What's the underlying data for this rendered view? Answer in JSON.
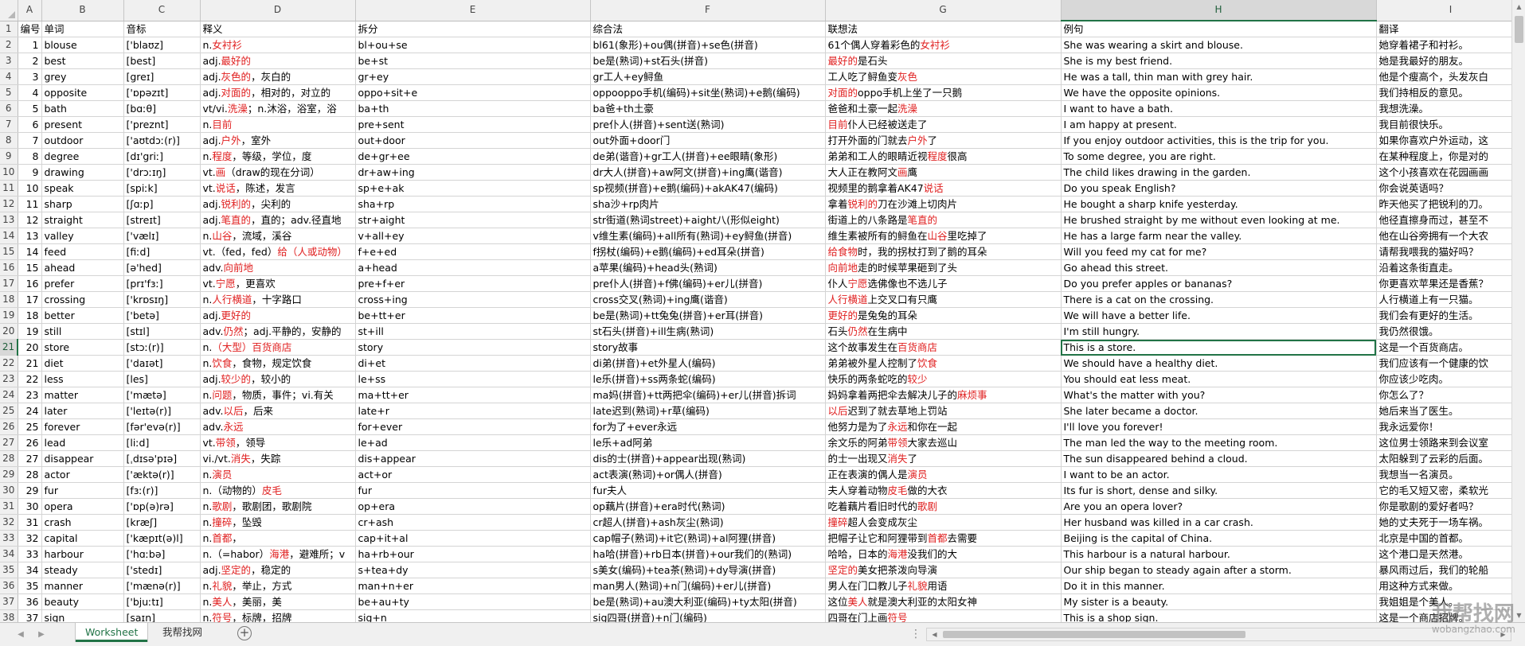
{
  "columns": [
    "A",
    "B",
    "C",
    "D",
    "E",
    "F",
    "G",
    "H",
    "I"
  ],
  "selected_column": "H",
  "selected_row": "21",
  "headers": [
    "编号",
    "单词",
    "音标",
    "释义",
    "拆分",
    "综合法",
    "联想法",
    "例句",
    "翻译"
  ],
  "rows": [
    [
      "1",
      "blouse",
      "['blaʊz]",
      [
        [
          "n.",
          ""
        ],
        [
          "女衬衫",
          "r"
        ]
      ],
      "bl+ou+se",
      "bl61(象形)+ou偶(拼音)+se色(拼音)",
      [
        [
          "61个偶人穿着彩色的",
          ""
        ],
        [
          "女衬衫",
          "r"
        ]
      ],
      "She was wearing a skirt and blouse.",
      "她穿着裙子和衬衫。"
    ],
    [
      "2",
      "best",
      "[best]",
      [
        [
          "adj.",
          ""
        ],
        [
          "最好的",
          "r"
        ]
      ],
      "be+st",
      "be是(熟词)+st石头(拼音)",
      [
        [
          "最好的",
          "r"
        ],
        [
          "是石头",
          ""
        ]
      ],
      "She is my best friend.",
      "她是我最好的朋友。"
    ],
    [
      "3",
      "grey",
      "[greɪ]",
      [
        [
          "adj.",
          ""
        ],
        [
          "灰色的",
          "r"
        ],
        [
          "，灰白的",
          ""
        ]
      ],
      "gr+ey",
      "gr工人+ey鲟鱼",
      [
        [
          "工人吃了鲟鱼变",
          ""
        ],
        [
          "灰色",
          "r"
        ]
      ],
      "He was a tall, thin man with grey hair.",
      "他是个瘦高个，头发灰白"
    ],
    [
      "4",
      "opposite",
      "['ɒpəzɪt]",
      [
        [
          "adj.",
          ""
        ],
        [
          "对面的",
          "r"
        ],
        [
          "，相对的，对立的",
          ""
        ]
      ],
      "oppo+sit+e",
      "oppooppo手机(编码)+sit坐(熟词)+e鹅(编码)",
      [
        [
          "对面的",
          "r"
        ],
        [
          "oppo手机上坐了一只鹅",
          ""
        ]
      ],
      "We have the opposite opinions.",
      "我们持相反的意见。"
    ],
    [
      "5",
      "bath",
      "[bɑːθ]",
      [
        [
          "vt/vi.",
          ""
        ],
        [
          "洗澡",
          "r"
        ],
        [
          "；n.沐浴，浴室，浴",
          ""
        ]
      ],
      "ba+th",
      "ba爸+th土豪",
      [
        [
          "爸爸和土豪一起",
          ""
        ],
        [
          "洗澡",
          "r"
        ]
      ],
      "I want to have a bath.",
      "我想洗澡。"
    ],
    [
      "6",
      "present",
      "['preznt]",
      [
        [
          "n.",
          ""
        ],
        [
          "目前",
          "r"
        ]
      ],
      "pre+sent",
      "pre仆人(拼音)+sent送(熟词)",
      [
        [
          "目前",
          "r"
        ],
        [
          "仆人已经被送走了",
          ""
        ]
      ],
      "I am happy at present.",
      "我目前很快乐。"
    ],
    [
      "7",
      "outdoor",
      "['aʊtdɔː(r)]",
      [
        [
          "adj.",
          ""
        ],
        [
          "户外",
          "r"
        ],
        [
          "，室外",
          ""
        ]
      ],
      "out+door",
      "out外面+door门",
      [
        [
          "打开外面的门就去",
          ""
        ],
        [
          "户外",
          "r"
        ],
        [
          "了",
          ""
        ]
      ],
      "If you enjoy outdoor activities, this is the trip for you.",
      "如果你喜欢户外运动，这"
    ],
    [
      "8",
      "degree",
      "[dɪ'griː]",
      [
        [
          "n.",
          ""
        ],
        [
          "程度",
          "r"
        ],
        [
          "，等级，学位，度",
          ""
        ]
      ],
      "de+gr+ee",
      "de弟(谐音)+gr工人(拼音)+ee眼睛(象形)",
      [
        [
          "弟弟和工人的眼睛近视",
          ""
        ],
        [
          "程度",
          "r"
        ],
        [
          "很高",
          ""
        ]
      ],
      "To some degree, you are right.",
      "在某种程度上，你是对的"
    ],
    [
      "9",
      "drawing",
      "['drɔːɪŋ]",
      [
        [
          "vt.",
          ""
        ],
        [
          "画",
          "r"
        ],
        [
          "（draw的现在分词）",
          ""
        ]
      ],
      "dr+aw+ing",
      "dr大人(拼音)+aw阿文(拼音)+ing鹰(谐音)",
      [
        [
          "大人正在教阿文",
          ""
        ],
        [
          "画",
          "r"
        ],
        [
          "鹰",
          ""
        ]
      ],
      "The child likes drawing in the garden.",
      "这个小孩喜欢在花园画画"
    ],
    [
      "10",
      "speak",
      "[spiːk]",
      [
        [
          "vt.",
          ""
        ],
        [
          "说话",
          "r"
        ],
        [
          "，陈述，发言",
          ""
        ]
      ],
      "sp+e+ak",
      "sp视频(拼音)+e鹅(编码)+akAK47(编码)",
      [
        [
          "视频里的鹅拿着AK47",
          ""
        ],
        [
          "说话",
          "r"
        ]
      ],
      "Do you speak English?",
      "你会说英语吗？"
    ],
    [
      "11",
      "sharp",
      "[ʃɑːp]",
      [
        [
          "adj.",
          ""
        ],
        [
          "锐利的",
          "r"
        ],
        [
          "，尖利的",
          ""
        ]
      ],
      "sha+rp",
      "sha沙+rp肉片",
      [
        [
          "拿着",
          ""
        ],
        [
          "锐利的",
          "r"
        ],
        [
          "刀在沙滩上切肉片",
          ""
        ]
      ],
      "He bought a sharp knife yesterday.",
      "昨天他买了把锐利的刀。"
    ],
    [
      "12",
      "straight",
      "[streɪt]",
      [
        [
          "adj.",
          ""
        ],
        [
          "笔直的",
          "r"
        ],
        [
          "，直的；adv.径直地",
          ""
        ]
      ],
      "str+aight",
      "str街道(熟词street)+aight八(形似eight)",
      [
        [
          "街道上的八条路是",
          ""
        ],
        [
          "笔直的",
          "r"
        ]
      ],
      "He brushed straight by me without even looking at me.",
      "他径直擦身而过，甚至不"
    ],
    [
      "13",
      "valley",
      "['vælɪ]",
      [
        [
          "n.",
          ""
        ],
        [
          "山谷",
          "r"
        ],
        [
          "，流域，溪谷",
          ""
        ]
      ],
      "v+all+ey",
      "v维生素(编码)+all所有(熟词)+ey鲟鱼(拼音)",
      [
        [
          "维生素被所有的鲟鱼在",
          ""
        ],
        [
          "山谷",
          "r"
        ],
        [
          "里吃掉了",
          ""
        ]
      ],
      "He has a large farm near the valley.",
      "他在山谷旁拥有一个大农"
    ],
    [
      "14",
      "feed",
      "[fiːd]",
      [
        [
          "vt.（fed，fed）",
          ""
        ],
        [
          "给（人或动物）",
          "r"
        ]
      ],
      "f+e+ed",
      "f拐杖(编码)+e鹅(编码)+ed耳朵(拼音)",
      [
        [
          "给食物",
          "r"
        ],
        [
          "时，我的拐杖打到了鹅的耳朵",
          ""
        ]
      ],
      "Will you feed my cat for me?",
      "请帮我喂我的猫好吗？"
    ],
    [
      "15",
      "ahead",
      "[ə'hed]",
      [
        [
          "adv.",
          ""
        ],
        [
          "向前地",
          "r"
        ]
      ],
      "a+head",
      "a苹果(编码)+head头(熟词)",
      [
        [
          "向前地",
          "r"
        ],
        [
          "走的时候苹果砸到了头",
          ""
        ]
      ],
      "Go ahead this street.",
      "沿着这条街直走。"
    ],
    [
      "16",
      "prefer",
      "[prɪ'fɜː]",
      [
        [
          "vt.",
          ""
        ],
        [
          "宁愿",
          "r"
        ],
        [
          "，更喜欢",
          ""
        ]
      ],
      "pre+f+er",
      "pre仆人(拼音)+f佛(编码)+er儿(拼音)",
      [
        [
          "仆人",
          ""
        ],
        [
          "宁愿",
          "r"
        ],
        [
          "选佛像也不选儿子",
          ""
        ]
      ],
      "Do you prefer apples or bananas?",
      "你更喜欢苹果还是香蕉？"
    ],
    [
      "17",
      "crossing",
      "['krɒsɪŋ]",
      [
        [
          "n.",
          ""
        ],
        [
          "人行横道",
          "r"
        ],
        [
          "，十字路口",
          ""
        ]
      ],
      "cross+ing",
      "cross交叉(熟词)+ing鹰(谐音)",
      [
        [
          "人行横道",
          "r"
        ],
        [
          "上交叉口有只鹰",
          ""
        ]
      ],
      "There is a cat on the crossing.",
      "人行横道上有一只猫。"
    ],
    [
      "18",
      "better",
      "['betə]",
      [
        [
          "adj.",
          ""
        ],
        [
          "更好的",
          "r"
        ]
      ],
      "be+tt+er",
      "be是(熟词)+tt兔兔(拼音)+er耳(拼音)",
      [
        [
          "更好的",
          "r"
        ],
        [
          "是兔兔的耳朵",
          ""
        ]
      ],
      "We will have a better life.",
      "我们会有更好的生活。"
    ],
    [
      "19",
      "still",
      "[stɪl]",
      [
        [
          "adv.",
          ""
        ],
        [
          "仍然",
          "r"
        ],
        [
          "；adj.平静的，安静的",
          ""
        ]
      ],
      "st+ill",
      "st石头(拼音)+ill生病(熟词)",
      [
        [
          "石头",
          ""
        ],
        [
          "仍然",
          "r"
        ],
        [
          "在生病中",
          ""
        ]
      ],
      "I'm still hungry.",
      "我仍然很饿。"
    ],
    [
      "20",
      "store",
      "[stɔː(r)]",
      [
        [
          "n.",
          ""
        ],
        [
          "（大型）百货商店",
          "r"
        ]
      ],
      "story",
      "story故事",
      [
        [
          "这个故事发生在",
          ""
        ],
        [
          "百货商店",
          "r"
        ]
      ],
      "This is a store.",
      "这是一个百货商店。"
    ],
    [
      "21",
      "diet",
      "['daɪət]",
      [
        [
          "n.",
          ""
        ],
        [
          "饮食",
          "r"
        ],
        [
          "，食物，规定饮食",
          ""
        ]
      ],
      "di+et",
      "di弟(拼音)+et外星人(编码)",
      [
        [
          "弟弟被外星人控制了",
          ""
        ],
        [
          "饮食",
          "r"
        ]
      ],
      "We should have a healthy diet.",
      "我们应该有一个健康的饮"
    ],
    [
      "22",
      "less",
      "[les]",
      [
        [
          "adj.",
          ""
        ],
        [
          "较少的",
          "r"
        ],
        [
          "，较小的",
          ""
        ]
      ],
      "le+ss",
      "le乐(拼音)+ss两条蛇(编码)",
      [
        [
          "快乐的两条蛇吃的",
          ""
        ],
        [
          "较少",
          "r"
        ]
      ],
      "You should eat less meat.",
      "你应该少吃肉。"
    ],
    [
      "23",
      "matter",
      "['mætə]",
      [
        [
          "n.",
          ""
        ],
        [
          "问题",
          "r"
        ],
        [
          "，物质，事件；vi.有关",
          ""
        ]
      ],
      "ma+tt+er",
      "ma妈(拼音)+tt两把伞(编码)+er儿(拼音)拆词",
      [
        [
          "妈妈拿着两把伞去解决儿子的",
          ""
        ],
        [
          "麻烦事",
          "r"
        ]
      ],
      "What's the matter with you?",
      "你怎么了？"
    ],
    [
      "24",
      "later",
      "['leɪtə(r)]",
      [
        [
          "adv.",
          ""
        ],
        [
          "以后",
          "r"
        ],
        [
          "，后来",
          ""
        ]
      ],
      "late+r",
      "late迟到(熟词)+r草(编码)",
      [
        [
          "以后",
          "r"
        ],
        [
          "迟到了就去草地上罚站",
          ""
        ]
      ],
      "She later became a doctor.",
      "她后来当了医生。"
    ],
    [
      "25",
      "forever",
      "[fər'evə(r)]",
      [
        [
          "adv.",
          ""
        ],
        [
          "永远",
          "r"
        ]
      ],
      "for+ever",
      "for为了+ever永远",
      [
        [
          "他努力是为了",
          ""
        ],
        [
          "永远",
          "r"
        ],
        [
          "和你在一起",
          ""
        ]
      ],
      "I'll love you forever!",
      "我永远爱你！"
    ],
    [
      "26",
      "lead",
      "[liːd]",
      [
        [
          "vt.",
          ""
        ],
        [
          "带领",
          "r"
        ],
        [
          "，领导",
          ""
        ]
      ],
      "le+ad",
      "le乐+ad阿弟",
      [
        [
          "余文乐的阿弟",
          ""
        ],
        [
          "带领",
          "r"
        ],
        [
          "大家去巡山",
          ""
        ]
      ],
      "The man led the way to the meeting room.",
      "这位男士领路来到会议室"
    ],
    [
      "27",
      "disappear",
      "[ˌdɪsə'pɪə]",
      [
        [
          "vi./vt.",
          ""
        ],
        [
          "消失",
          "r"
        ],
        [
          "，失踪",
          ""
        ]
      ],
      "dis+appear",
      "dis的士(拼音)+appear出现(熟词)",
      [
        [
          "的士一出现又",
          ""
        ],
        [
          "消失",
          "r"
        ],
        [
          "了",
          ""
        ]
      ],
      "The sun disappeared behind a cloud.",
      "太阳躲到了云彩的后面。"
    ],
    [
      "28",
      "actor",
      "['æktə(r)]",
      [
        [
          "n.",
          ""
        ],
        [
          "演员",
          "r"
        ]
      ],
      "act+or",
      "act表演(熟词)+or偶人(拼音)",
      [
        [
          "正在表演的偶人是",
          ""
        ],
        [
          "演员",
          "r"
        ]
      ],
      "I want to be an actor.",
      "我想当一名演员。"
    ],
    [
      "29",
      "fur",
      "[fɜː(r)]",
      [
        [
          "n.（动物的）",
          ""
        ],
        [
          "皮毛",
          "r"
        ]
      ],
      "fur",
      "fur夫人",
      [
        [
          "夫人穿着动物",
          ""
        ],
        [
          "皮毛",
          "r"
        ],
        [
          "做的大衣",
          ""
        ]
      ],
      "Its fur is short, dense and silky.",
      "它的毛又短又密，柔软光"
    ],
    [
      "30",
      "opera",
      "['ɒp(ə)rə]",
      [
        [
          "n.",
          ""
        ],
        [
          "歌剧",
          "r"
        ],
        [
          "，歌剧团，歌剧院",
          ""
        ]
      ],
      "op+era",
      "op藕片(拼音)+era时代(熟词)",
      [
        [
          "吃着藕片看旧时代的",
          ""
        ],
        [
          "歌剧",
          "r"
        ]
      ],
      "Are you an opera lover?",
      "你是歌剧的爱好者吗？"
    ],
    [
      "31",
      "crash",
      "[kræʃ]",
      [
        [
          "n.",
          ""
        ],
        [
          "撞碎",
          "r"
        ],
        [
          "，坠毁",
          ""
        ]
      ],
      "cr+ash",
      "cr超人(拼音)+ash灰尘(熟词)",
      [
        [
          "撞碎",
          "r"
        ],
        [
          "超人会变成灰尘",
          ""
        ]
      ],
      "Her husband was killed in a car crash.",
      "她的丈夫死于一场车祸。"
    ],
    [
      "32",
      "capital",
      "['kæpɪt(ə)l]",
      [
        [
          "n.",
          ""
        ],
        [
          "首都",
          "r"
        ],
        [
          "，",
          ""
        ]
      ],
      "cap+it+al",
      "cap帽子(熟词)+it它(熟词)+al阿狸(拼音)",
      [
        [
          "把帽子让它和阿狸带到",
          ""
        ],
        [
          "首都",
          "r"
        ],
        [
          "去需要",
          ""
        ]
      ],
      "Beijing is the capital of China.",
      "北京是中国的首都。"
    ],
    [
      "33",
      "harbour",
      "['hɑːbə]",
      [
        [
          "n.（=habor）",
          ""
        ],
        [
          "海港",
          "r"
        ],
        [
          "，避难所；v",
          ""
        ]
      ],
      "ha+rb+our",
      "ha哈(拼音)+rb日本(拼音)+our我们的(熟词)",
      [
        [
          "哈哈，日本的",
          ""
        ],
        [
          "海港",
          "r"
        ],
        [
          "没我们的大",
          ""
        ]
      ],
      "This harbour is a natural harbour.",
      "这个港口是天然港。"
    ],
    [
      "34",
      "steady",
      "['stedɪ]",
      [
        [
          "adj.",
          ""
        ],
        [
          "坚定的",
          "r"
        ],
        [
          "，稳定的",
          ""
        ]
      ],
      "s+tea+dy",
      "s美女(编码)+tea茶(熟词)+dy导演(拼音)",
      [
        [
          "坚定的",
          "r"
        ],
        [
          "美女把茶泼向导演",
          ""
        ]
      ],
      "Our ship began to steady again after a storm.",
      "暴风雨过后，我们的轮船"
    ],
    [
      "35",
      "manner",
      "['mænə(r)]",
      [
        [
          "n.",
          ""
        ],
        [
          "礼貌",
          "r"
        ],
        [
          "，举止，方式",
          ""
        ]
      ],
      "man+n+er",
      "man男人(熟词)+n门(编码)+er儿(拼音)",
      [
        [
          "男人在门口教儿子",
          ""
        ],
        [
          "礼貌",
          "r"
        ],
        [
          "用语",
          ""
        ]
      ],
      "Do it in this manner.",
      "用这种方式来做。"
    ],
    [
      "36",
      "beauty",
      "['bjuːtɪ]",
      [
        [
          "n.",
          ""
        ],
        [
          "美人",
          "r"
        ],
        [
          "，美丽，美",
          ""
        ]
      ],
      "be+au+ty",
      "be是(熟词)+au澳大利亚(编码)+ty太阳(拼音)",
      [
        [
          "这位",
          ""
        ],
        [
          "美人",
          "r"
        ],
        [
          "就是澳大利亚的太阳女神",
          ""
        ]
      ],
      "My sister is a beauty.",
      "我姐姐是个美人。"
    ],
    [
      "37",
      "sign",
      "[saɪn]",
      [
        [
          "n.",
          ""
        ],
        [
          "符号",
          "r"
        ],
        [
          "，标牌，招牌",
          ""
        ]
      ],
      "sig+n",
      "sig四哥(拼音)+n门(编码)",
      [
        [
          "四哥在门上画",
          ""
        ],
        [
          "符号",
          "r"
        ]
      ],
      "This is a shop sign.",
      "这是一个商店招牌。"
    ]
  ],
  "sheet_tabs": [
    "Worksheet",
    "我帮找网"
  ],
  "watermark": {
    "text": "我帮找网",
    "url": "wobangzhao.com"
  }
}
